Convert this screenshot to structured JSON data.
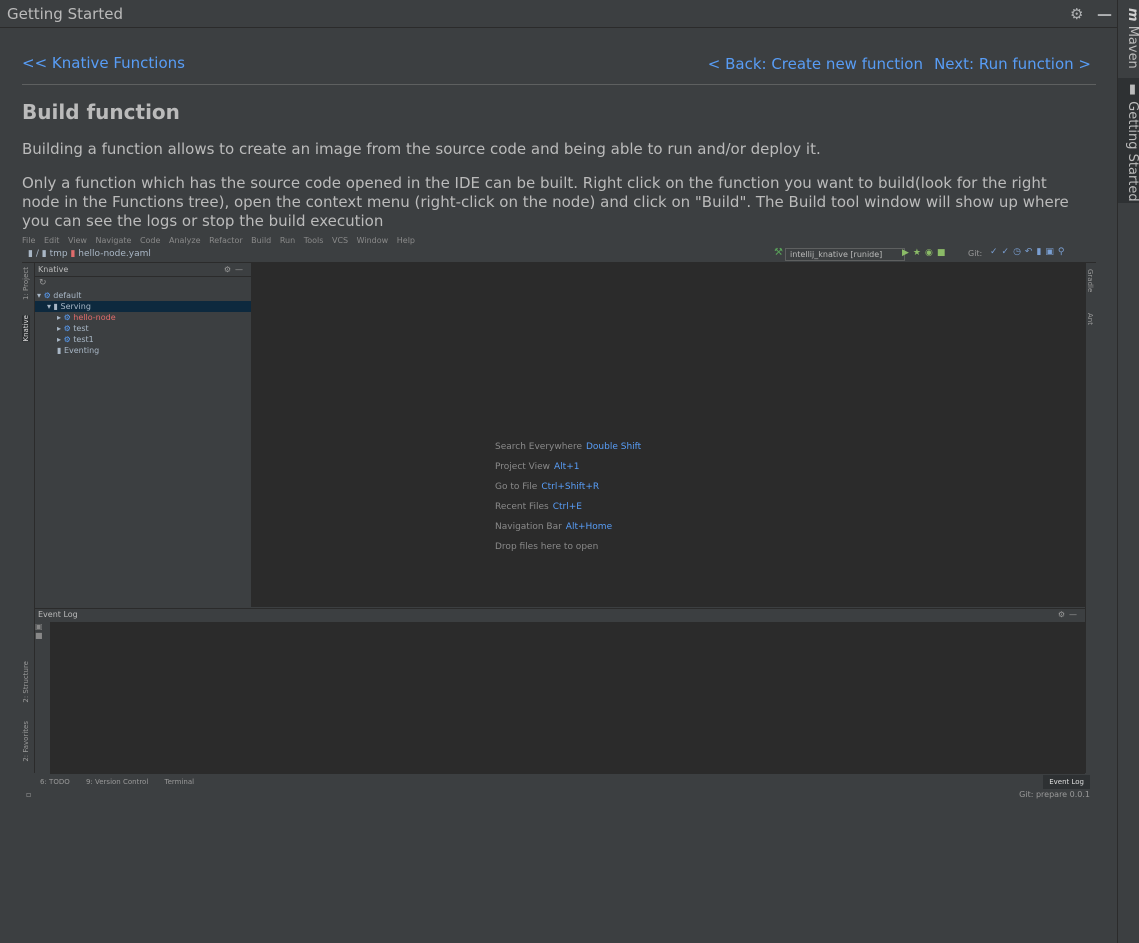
{
  "window": {
    "title": "Getting Started",
    "settings_icon": "gear-icon",
    "minimize_icon": "minimize-icon"
  },
  "side_tabs": {
    "maven": "Maven",
    "maven_icon": "m",
    "getting_started": "Getting Started"
  },
  "nav": {
    "home": "<< Knative Functions",
    "back": "< Back: Create new function",
    "next": "Next: Run function >"
  },
  "page": {
    "heading": "Build function",
    "p1": "Building a function allows to create an image from the source code and being able to run and/or deploy it.",
    "p2": "Only a function which has the source code opened in the IDE can be built. Right click on the function you want to build(look for the right node in the Functions tree), open the context menu (right-click on the node) and click on \"Build\". The Build tool window will show up where you can see the logs or stop the build execution"
  },
  "screenshot": {
    "menu": [
      "File",
      "Edit",
      "View",
      "Navigate",
      "Code",
      "Analyze",
      "Refactor",
      "Build",
      "Run",
      "Tools",
      "VCS",
      "Window",
      "Help"
    ],
    "breadcrumb": {
      "root": "/",
      "folder": "tmp",
      "file": "hello-node.yaml"
    },
    "run_config": "intellij_knative [runide]",
    "git_label": "Git:",
    "left_tabs": {
      "project": "1: Project",
      "knative": "Knative",
      "structure": "2: Structure",
      "favorites": "2: Favorites"
    },
    "right_tabs": {
      "gradle": "Gradle",
      "ant": "Ant"
    },
    "panel_title": "Knative",
    "tree": {
      "default": "default",
      "serving": "Serving",
      "hello_node": "hello-node",
      "test": "test",
      "test1": "test1",
      "eventing": "Eventing"
    },
    "hints": [
      {
        "label": "Search Everywhere",
        "key": "Double Shift"
      },
      {
        "label": "Project View",
        "key": "Alt+1"
      },
      {
        "label": "Go to File",
        "key": "Ctrl+Shift+R"
      },
      {
        "label": "Recent Files",
        "key": "Ctrl+E"
      },
      {
        "label": "Navigation Bar",
        "key": "Alt+Home"
      },
      {
        "label": "Drop files here to open",
        "key": ""
      }
    ],
    "bottom_title": "Event Log",
    "bottom_tabs": {
      "todo": "6: TODO",
      "vcs": "9: Version Control",
      "terminal": "Terminal",
      "event_log": "Event Log"
    },
    "status_right": "Git: prepare  0.0.1"
  }
}
